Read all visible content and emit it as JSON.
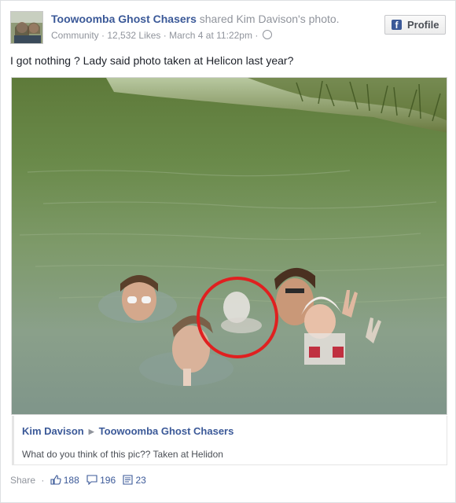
{
  "post": {
    "page_name": "Toowoomba Ghost Chasers",
    "shared_text": "shared",
    "shared_owner": "Kim Davison's",
    "shared_object": "photo.",
    "category": "Community",
    "likes_page": "12,532 Likes",
    "date": "March 4 at 11:22pm",
    "separator": "·",
    "profile_button_label": "Profile",
    "message": "I got nothing ? Lady said photo taken at Helicon last year?"
  },
  "attribution": {
    "author": "Kim Davison",
    "target": "Toowoomba Ghost Chasers",
    "caption": "What do you think of this pic?? Taken at Helidon"
  },
  "actions": {
    "share_label": "Share",
    "separator": "·",
    "likes": "188",
    "comments": "196",
    "shares": "23"
  },
  "colors": {
    "link": "#3b5998",
    "muted": "#90949c",
    "highlight_circle": "#e02020"
  },
  "icons": [
    "facebook-icon",
    "globe-icon",
    "thumbs-up-icon",
    "comment-icon",
    "share-icon"
  ]
}
